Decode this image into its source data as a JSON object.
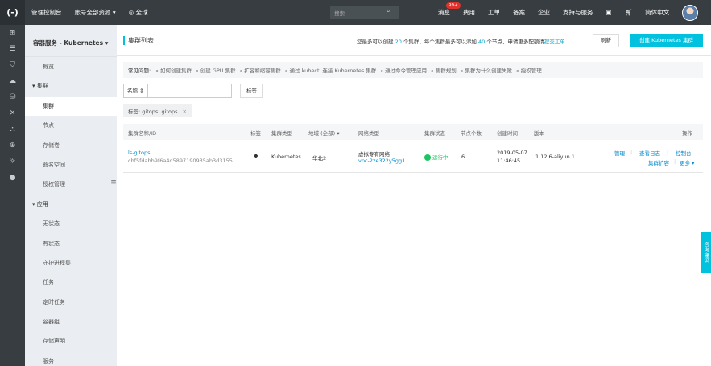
{
  "topbar": {
    "logo": "(-)",
    "console": "管理控制台",
    "account": "账号全部资源 ▾",
    "region": "全球",
    "search_placeholder": "搜索",
    "right_items": [
      "消息",
      "费用",
      "工单",
      "备案",
      "企业",
      "支持与服务"
    ],
    "message_badge": "99+",
    "language": "简体中文"
  },
  "left_icons": [
    "grid-icon",
    "menu-icon",
    "shield-icon",
    "cloud-icon",
    "database-icon",
    "cross-icon",
    "network-icon",
    "globe-icon",
    "cloud-outline-icon",
    "circle-icon"
  ],
  "nav": {
    "title": "容器服务 - Kubernetes ▾",
    "items": [
      {
        "label": "概览",
        "type": "item"
      },
      {
        "label": "▾  集群",
        "type": "group"
      },
      {
        "label": "集群",
        "type": "item",
        "active": true
      },
      {
        "label": "节点",
        "type": "item"
      },
      {
        "label": "存储卷",
        "type": "item"
      },
      {
        "label": "命名空间",
        "type": "item"
      },
      {
        "label": "授权管理",
        "type": "item"
      },
      {
        "label": "▾  应用",
        "type": "group"
      },
      {
        "label": "无状态",
        "type": "item"
      },
      {
        "label": "有状态",
        "type": "item"
      },
      {
        "label": "守护进程集",
        "type": "item"
      },
      {
        "label": "任务",
        "type": "item"
      },
      {
        "label": "定时任务",
        "type": "item"
      },
      {
        "label": "容器组",
        "type": "item"
      },
      {
        "label": "存储声明",
        "type": "item"
      },
      {
        "label": "服务",
        "type": "item"
      }
    ]
  },
  "page": {
    "title": "集群列表",
    "note_prefix": "您最多可以创建 ",
    "note_n1": "20",
    "note_mid": " 个集群，每个集群最多可以添加 ",
    "note_n2": "40",
    "note_suffix": " 个节点，申请更多配额请",
    "note_link": "提交工单",
    "refresh": "刷新",
    "create": "创建 Kubernetes 集群"
  },
  "faq": {
    "label": "常见问题:",
    "items": [
      "如何创建集群",
      "创建 GPU 集群",
      "扩容和缩容集群",
      "通过 kubectl 连接 Kubernetes 集群",
      "通过命令管理应用",
      "集群规划",
      "集群为什么创建失败",
      "授权管理"
    ]
  },
  "filter": {
    "select": "名称 ⇕",
    "button": "标签",
    "chip": "标签: gitops: gitops",
    "chip_close": "✕"
  },
  "table": {
    "headers": [
      "集群名称/ID",
      "标签",
      "集群类型",
      "地域 (全部) ▾",
      "网络类型",
      "集群状态",
      "节点个数",
      "创建时间",
      "版本",
      "操作"
    ],
    "rows": [
      {
        "name": "ls-gitops",
        "id": "cbf5fdabb9f6a4d5897190935ab3d3155",
        "type": "Kubernetes",
        "region": "华北2",
        "network": "虚拟专有网络",
        "vpc": "vpc-2ze322y5gg1...",
        "status": "运行中",
        "nodes": "6",
        "date": "2019-05-07",
        "time": "11:46:45",
        "version": "1.12.6-aliyun.1",
        "ops": {
          "manage": "管理",
          "logs": "查看日志",
          "console": "控制台",
          "scale": "集群扩容",
          "more": "更多 ▾"
        }
      }
    ]
  },
  "feedback": "咨询·建议"
}
